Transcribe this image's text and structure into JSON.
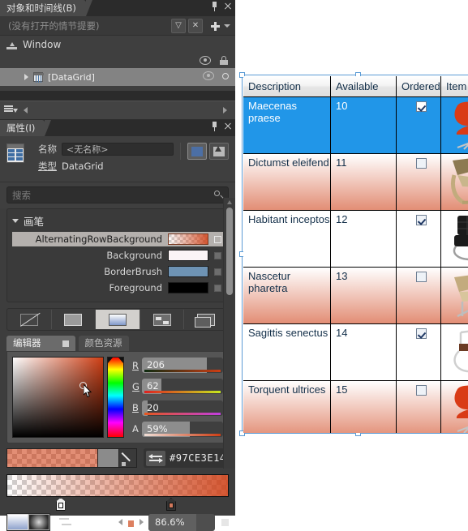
{
  "left_panel": {
    "objects_timeline": {
      "tab_label": "对象和时间线(B)",
      "pin_icon": "pin-icon",
      "close_icon": "close-icon",
      "storyboard_placeholder": "(没有打开的情节提要)",
      "storyboard_btn1": "chevron-double-down-icon",
      "storyboard_btn2": "close-x-icon",
      "add_icon": "plus-icon",
      "add_caret": "caret-down-icon",
      "tree": {
        "root_label": "Window",
        "root_icon": "window-icon",
        "eye_icon": "eye-icon",
        "lock_icon": "lock-icon",
        "child_label": "[DataGrid]",
        "child_icon": "datagrid-icon",
        "expand_icon": "triangle-right-icon",
        "child_eye_icon": "eye-icon",
        "child_lock_icon": "circle-icon"
      },
      "mini_toolbar": {
        "stack_icon": "layers-icon",
        "prev_icon": "arrow-left-icon",
        "next_icon": "arrow-right-icon"
      }
    },
    "properties": {
      "tab_label": "属性(I)",
      "pin_icon": "pin-icon",
      "close_icon": "close-icon",
      "element_icon": "datagrid-icon",
      "name_label": "名称",
      "name_value": "<无名称>",
      "type_label": "类型",
      "type_value": "DataGrid",
      "mode_properties_icon": "properties-icon",
      "mode_events_icon": "events-icon",
      "search_placeholder": "搜索",
      "search_icon": "search-icon"
    },
    "brushes": {
      "section_title": "画笔",
      "collapse_icon": "triangle-down-icon",
      "rows": [
        {
          "name": "AlternatingRowBackground",
          "swatch": "gradient-orange",
          "marker": "hollow",
          "selected": true
        },
        {
          "name": "Background",
          "swatch": "#FBF4F6",
          "marker": "grey",
          "selected": false
        },
        {
          "name": "BorderBrush",
          "swatch": "#6E93B4",
          "marker": "grey",
          "selected": false
        },
        {
          "name": "Foreground",
          "swatch": "#000000",
          "marker": "grey",
          "selected": false
        }
      ]
    },
    "brush_types": [
      {
        "name": "no-brush",
        "icon": "no-brush-icon",
        "selected": false
      },
      {
        "name": "solid-color-brush",
        "icon": "solid-brush-icon",
        "selected": false
      },
      {
        "name": "gradient-brush",
        "icon": "gradient-brush-icon",
        "selected": true
      },
      {
        "name": "tile-brush",
        "icon": "tile-brush-icon",
        "selected": false
      },
      {
        "name": "brush-resource",
        "icon": "resource-brush-icon",
        "selected": false
      }
    ],
    "editor": {
      "tab_editor": "编辑器",
      "tab_color_resources": "颜色资源",
      "tab_editor_marker": "square-icon",
      "sv_picker_icon": "saturation-value-picker",
      "hue_strip_icon": "hue-strip",
      "cursor_icon": "mouse-cursor-icon",
      "channels": [
        {
          "label": "R",
          "value": "206",
          "fill_pct": 80
        },
        {
          "label": "G",
          "value": "62",
          "fill_pct": 24
        },
        {
          "label": "B",
          "value": "20",
          "fill_pct": 8
        },
        {
          "label": "A",
          "value": "59%",
          "fill_pct": 59
        }
      ],
      "preview_icon": "color-preview",
      "eyedropper_icon": "eyedropper-icon",
      "swap_icon": "swap-colors-icon",
      "hex_value": "#97CE3E14"
    },
    "gradient": {
      "strip_icon": "gradient-strip",
      "stops": [
        {
          "position_pct": 24,
          "style": "light"
        },
        {
          "position_pct": 74,
          "style": "dark"
        }
      ],
      "type_linear_icon": "linear-gradient-icon",
      "type_radial_icon": "radial-gradient-icon",
      "reverse_icon": "reverse-gradient-icon",
      "nav_prev_icon": "arrow-left-icon",
      "nav_next_icon": "arrow-right-icon",
      "mid_stop_icon": "gradient-stop-icon",
      "offset_value": "86.6%",
      "offset_fill_pct": 72,
      "offset_marker": "square-icon"
    },
    "scrollbar": {
      "up_icon": "scroll-up-arrow",
      "thumb": "scroll-thumb"
    }
  },
  "artboard": {
    "selection_handles_icon": "selection-handle",
    "datagrid": {
      "columns": [
        "Description",
        "Available",
        "Ordered",
        "Item"
      ],
      "rows": [
        {
          "description": "Maecenas praese",
          "available": "10",
          "ordered": true,
          "item": "red-swan-chair",
          "state": "selected"
        },
        {
          "description": "Dictumst eleifend",
          "available": "11",
          "ordered": false,
          "item": "wood-lounge-chair",
          "state": "alt"
        },
        {
          "description": "Habitant inceptos",
          "available": "12",
          "ordered": true,
          "item": "black-barcelona-chair",
          "state": "plain"
        },
        {
          "description": "Nascetur pharetra",
          "available": "13",
          "ordered": false,
          "item": "tan-lounge-chair",
          "state": "alt"
        },
        {
          "description": "Sagittis senectus ",
          "available": "14",
          "ordered": true,
          "item": "brown-cantilever-chair",
          "state": "plain"
        },
        {
          "description": "Torquent ultrices",
          "available": "15",
          "ordered": false,
          "item": "red-swan-chair",
          "state": "alt"
        }
      ]
    }
  },
  "colors": {
    "accent_selection": "#2196E8",
    "alternating_row": "#CE3E14",
    "border_brush": "#6E93B4",
    "selection_frame": "#5B9BD5",
    "panel_bg": "#3D3D3D"
  }
}
